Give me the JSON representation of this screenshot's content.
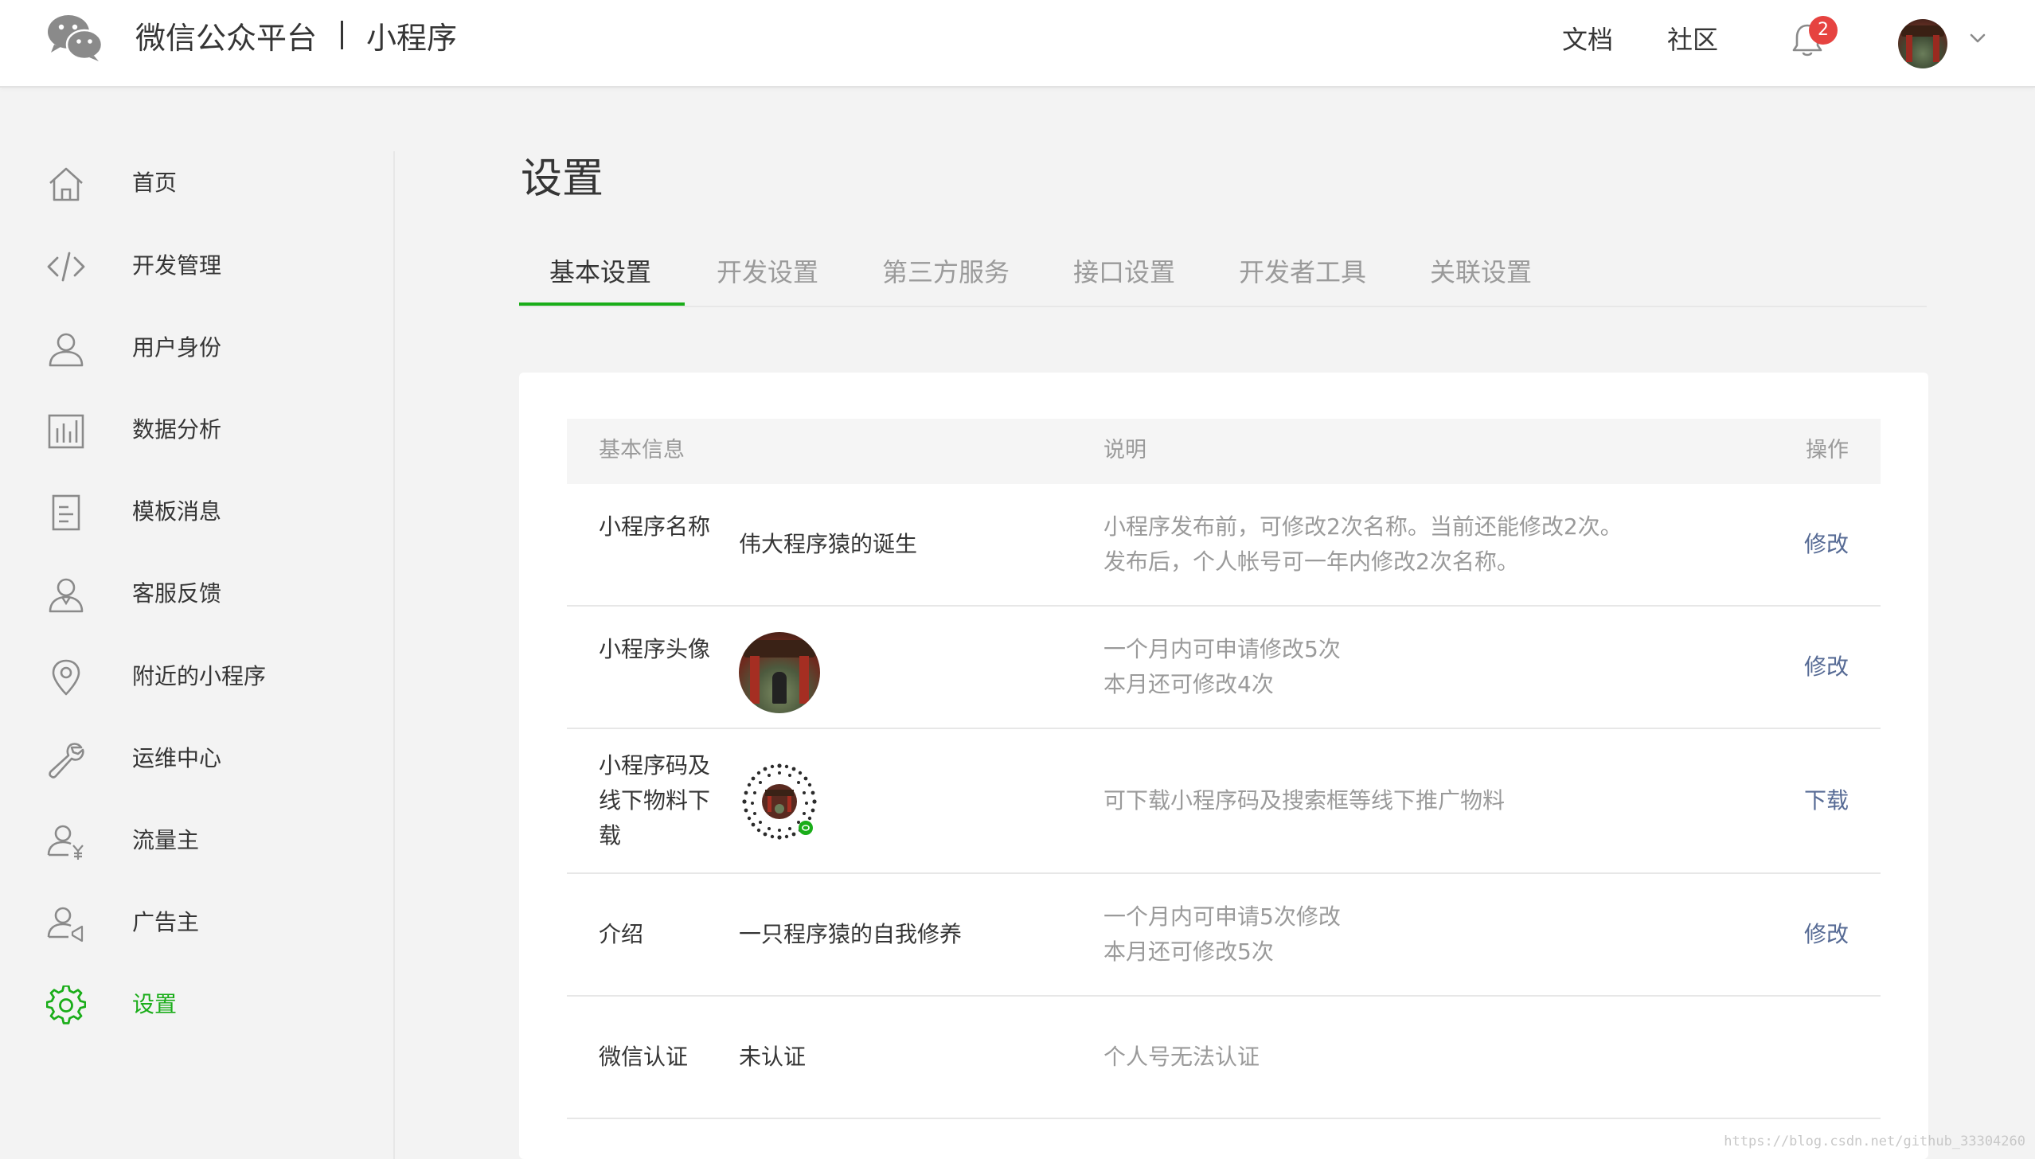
{
  "header": {
    "brand_name": "微信公众平台",
    "brand_separator": "|",
    "product_name": "小程序",
    "nav": {
      "docs": "文档",
      "community": "社区"
    },
    "notification_count": "2",
    "accent_color": "#1aad19",
    "badge_color": "#e64340"
  },
  "sidebar": {
    "items": [
      {
        "label": "首页",
        "icon": "home-icon"
      },
      {
        "label": "开发管理",
        "icon": "code-icon"
      },
      {
        "label": "用户身份",
        "icon": "user-icon"
      },
      {
        "label": "数据分析",
        "icon": "bar-chart-icon"
      },
      {
        "label": "模板消息",
        "icon": "document-icon"
      },
      {
        "label": "客服反馈",
        "icon": "support-user-icon"
      },
      {
        "label": "附近的小程序",
        "icon": "location-pin-icon"
      },
      {
        "label": "运维中心",
        "icon": "wrench-icon"
      },
      {
        "label": "流量主",
        "icon": "user-yuan-icon"
      },
      {
        "label": "广告主",
        "icon": "user-megaphone-icon"
      },
      {
        "label": "设置",
        "icon": "gear-icon",
        "active": true
      }
    ]
  },
  "main": {
    "title": "设置",
    "tabs": [
      {
        "label": "基本设置",
        "active": true
      },
      {
        "label": "开发设置"
      },
      {
        "label": "第三方服务"
      },
      {
        "label": "接口设置"
      },
      {
        "label": "开发者工具"
      },
      {
        "label": "关联设置"
      }
    ],
    "table": {
      "headers": {
        "info": "基本信息",
        "desc": "说明",
        "action": "操作"
      },
      "rows": [
        {
          "label": "小程序名称",
          "value": "伟大程序猿的诞生",
          "desc": [
            "小程序发布前，可修改2次名称。当前还能修改2次。",
            "发布后，个人帐号可一年内修改2次名称。"
          ],
          "action": "修改"
        },
        {
          "label": "小程序头像",
          "value_type": "avatar-image",
          "desc": [
            "一个月内可申请修改5次",
            "本月还可修改4次"
          ],
          "action": "修改"
        },
        {
          "label": "小程序码及线下物料下载",
          "value_type": "mini-program-code",
          "desc": [
            "可下载小程序码及搜索框等线下推广物料"
          ],
          "action": "下载"
        },
        {
          "label": "介绍",
          "value": "一只程序猿的自我修养",
          "desc": [
            "一个月内可申请5次修改",
            "本月还可修改5次"
          ],
          "action": "修改"
        },
        {
          "label": "微信认证",
          "value": "未认证",
          "desc": [
            "个人号无法认证"
          ],
          "action": ""
        }
      ]
    }
  },
  "watermark": "https://blog.csdn.net/github_33304260"
}
